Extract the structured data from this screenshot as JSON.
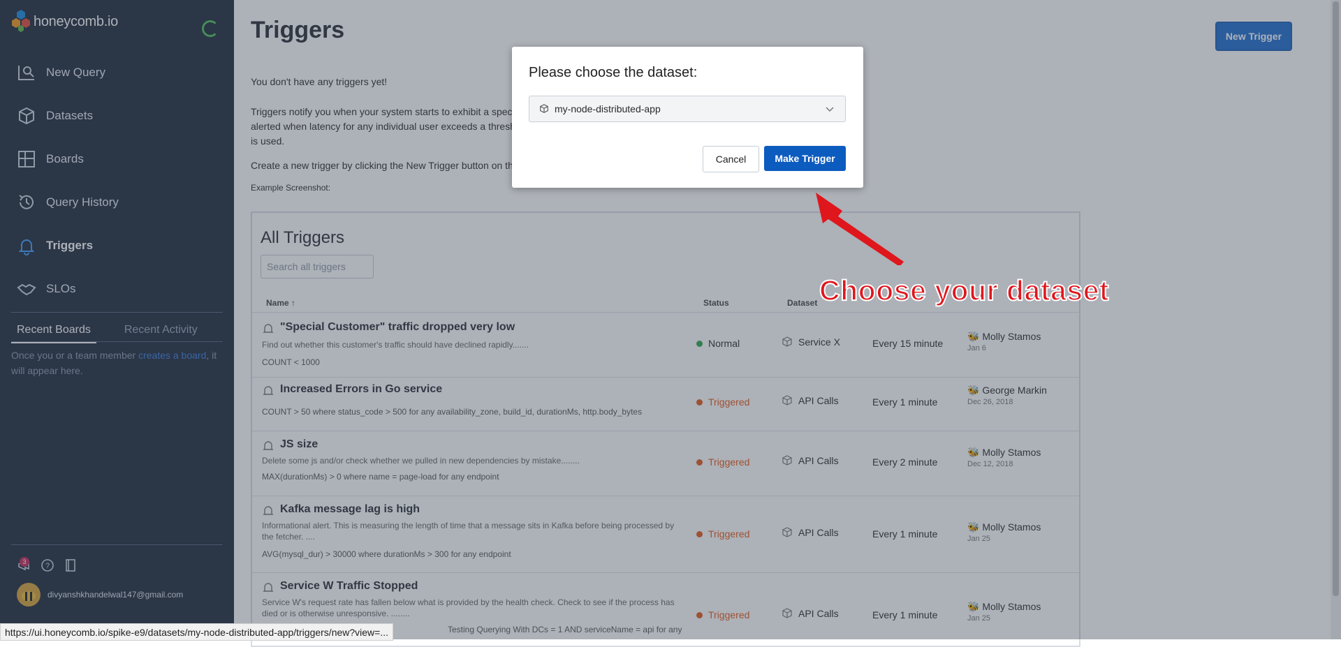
{
  "app": {
    "logo_text": "honeycomb.io"
  },
  "sidebar": {
    "nav": [
      {
        "label": "New Query",
        "icon": "query-icon"
      },
      {
        "label": "Datasets",
        "icon": "cube-icon"
      },
      {
        "label": "Boards",
        "icon": "boards-icon"
      },
      {
        "label": "Query History",
        "icon": "history-icon"
      },
      {
        "label": "Triggers",
        "icon": "bell-icon",
        "active": true
      },
      {
        "label": "SLOs",
        "icon": "handshake-icon"
      }
    ],
    "tabs": [
      "Recent Boards",
      "Recent Activity"
    ],
    "empty_pre": "Once you or a team member ",
    "empty_link": "creates a board",
    "empty_post": ", it will appear here.",
    "notification_count": "3",
    "user_email": "divyanshkhandelwal147@gmail.com"
  },
  "main": {
    "title": "Triggers",
    "new_trigger_label": "New Trigger",
    "no_triggers": "You don't have any triggers yet!",
    "desc_line1": "Triggers notify you when your system starts to exhibit a spec",
    "desc_line2": "alerted when latency for any individual user exceeds a thresh",
    "desc_line3": "is used.",
    "create_text": "Create a new trigger by clicking the New Trigger button on th",
    "example_label": "Example Screenshot:",
    "all_triggers_title": "All Triggers",
    "search_placeholder": "Search all triggers",
    "columns": {
      "name": "Name",
      "status": "Status",
      "dataset": "Dataset"
    },
    "rows": [
      {
        "title": "\"Special Customer\" traffic dropped very low",
        "desc": "Find out whether this customer's traffic should have declined rapidly.......",
        "query": "COUNT < 1000",
        "status": "Normal",
        "dataset": "Service X",
        "freq": "Every 15 minute",
        "owner": "Molly Stamos",
        "date": "Jan 6"
      },
      {
        "title": "Increased Errors in Go service",
        "desc": "",
        "query": "COUNT > 50 where status_code > 500 for any availability_zone, build_id, durationMs, http.body_bytes",
        "status": "Triggered",
        "dataset": "API Calls",
        "freq": "Every 1 minute",
        "owner": "George Markin",
        "date": "Dec 26, 2018"
      },
      {
        "title": "JS size",
        "desc": "Delete some js and/or check whether we pulled in new dependencies by mistake........",
        "query": "MAX(durationMs) > 0 where name = page-load for any endpoint",
        "status": "Triggered",
        "dataset": "API Calls",
        "freq": "Every 2 minute",
        "owner": "Molly Stamos",
        "date": "Dec 12, 2018"
      },
      {
        "title": "Kafka message lag is high",
        "desc": "Informational alert. This is measuring the length of time that a message sits in Kafka before being processed by the fetcher. ....",
        "query": "AVG(mysql_dur) > 30000 where durationMs > 300 for any endpoint",
        "status": "Triggered",
        "dataset": "API Calls",
        "freq": "Every 1 minute",
        "owner": "Molly Stamos",
        "date": "Jan 25"
      },
      {
        "title": "Service W Traffic Stopped",
        "desc": "Service W's request rate has fallen below what is provided by the health check. Check to see if the process has died or is otherwise unresponsive. ........",
        "query": "Testing Querying With DCs = 1 AND serviceName = api for any",
        "status": "Triggered",
        "dataset": "API Calls",
        "freq": "Every 1 minute",
        "owner": "Molly Stamos",
        "date": "Jan 25"
      }
    ]
  },
  "modal": {
    "title": "Please choose the dataset:",
    "selected_dataset": "my-node-distributed-app",
    "cancel_label": "Cancel",
    "make_label": "Make Trigger"
  },
  "annotation": {
    "text": "Choose your dataset",
    "color": "#e0161d"
  },
  "status_url": "https://ui.honeycomb.io/spike-e9/datasets/my-node-distributed-app/triggers/new?view=..."
}
